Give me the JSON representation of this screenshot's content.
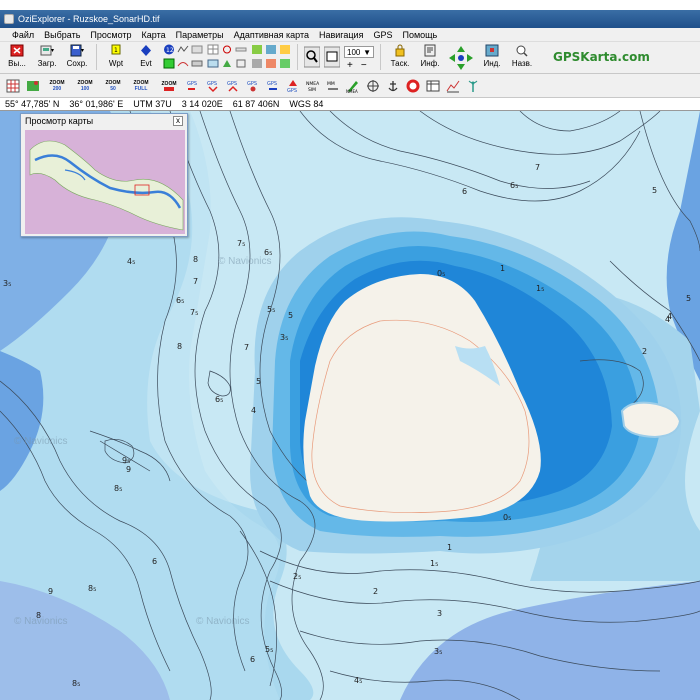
{
  "window": {
    "title": "OziExplorer - Ruzskoe_SonarHD.tif"
  },
  "menu": [
    "Файл",
    "Выбрать",
    "Просмотр",
    "Карта",
    "Параметры",
    "Адаптивная карта",
    "Навигация",
    "GPS",
    "Помощь"
  ],
  "toolbar": {
    "exit_label": "Вы...",
    "load_label": "Загр.",
    "save_label": "Сохр.",
    "wpt_label": "Wpt",
    "evt_label": "Evt",
    "zoom_value": "100",
    "task_label": "Таск.",
    "info_label": "Инф.",
    "ind_label": "Инд.",
    "names_label": "Назв.",
    "brand": "GPSKarta.com"
  },
  "zoom_buttons": [
    {
      "top": "ZOOM",
      "bottom": "200"
    },
    {
      "top": "ZOOM",
      "bottom": "100"
    },
    {
      "top": "ZOOM",
      "bottom": "50"
    },
    {
      "top": "ZOOM",
      "bottom": "FULL"
    },
    {
      "top": "ZOOM",
      "bottom": ""
    }
  ],
  "status": {
    "lat": "55° 47,785' N",
    "lon": "36° 01,986' E",
    "utm_zone": "UTM  37U",
    "easting": "3 14 020E",
    "northing": "61 87 406N",
    "datum": "WGS 84"
  },
  "overview": {
    "title": "Просмотр карты",
    "close": "x"
  },
  "watermarks": [
    "© Navionics",
    "© Navionics",
    "© Navionics",
    "© Navionics"
  ],
  "depth_labels": [
    {
      "text": "7"
    },
    {
      "text": "6₅"
    },
    {
      "text": "6"
    },
    {
      "text": "5"
    },
    {
      "text": "4"
    },
    {
      "text": "4₅"
    },
    {
      "text": "3₅"
    },
    {
      "text": "7₅"
    },
    {
      "text": "6₅"
    },
    {
      "text": "8"
    },
    {
      "text": "7"
    },
    {
      "text": "6₅"
    },
    {
      "text": "7₅"
    },
    {
      "text": "5₅"
    },
    {
      "text": "5"
    },
    {
      "text": "3₅"
    },
    {
      "text": "8"
    },
    {
      "text": "7"
    },
    {
      "text": "5"
    },
    {
      "text": "4"
    },
    {
      "text": "6₅"
    },
    {
      "text": "0₅"
    },
    {
      "text": "1"
    },
    {
      "text": "1₅"
    },
    {
      "text": "2"
    },
    {
      "text": "4"
    },
    {
      "text": "5"
    },
    {
      "text": "9₅"
    },
    {
      "text": "9"
    },
    {
      "text": "8₅"
    },
    {
      "text": "6"
    },
    {
      "text": "8₅"
    },
    {
      "text": "0₅"
    },
    {
      "text": "1"
    },
    {
      "text": "1₅"
    },
    {
      "text": "2₅"
    },
    {
      "text": "2"
    },
    {
      "text": "3"
    },
    {
      "text": "3₅"
    },
    {
      "text": "4₅"
    },
    {
      "text": "5₅"
    },
    {
      "text": "6"
    },
    {
      "text": "8₅"
    },
    {
      "text": "8"
    },
    {
      "text": "9"
    }
  ],
  "colors": {
    "shallow": "#c8e8f4",
    "mid": "#a4d4ec",
    "deep": "#4aa6e0",
    "deepest": "#1e88d8",
    "island": "#f5f2ea",
    "band_purple": "#8fb3e8"
  }
}
